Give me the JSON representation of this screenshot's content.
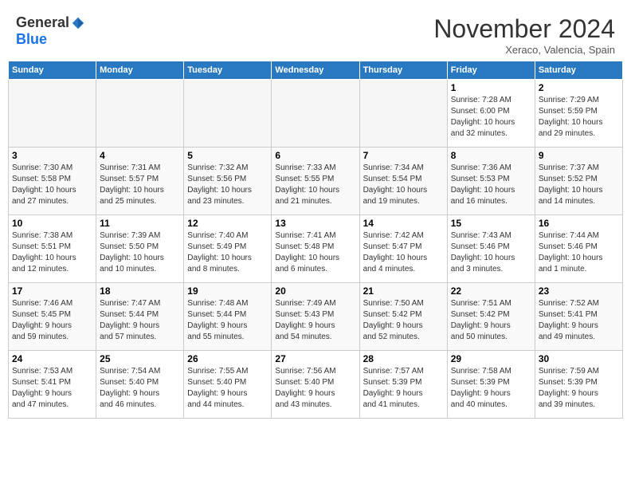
{
  "header": {
    "logo_general": "General",
    "logo_blue": "Blue",
    "month_title": "November 2024",
    "subtitle": "Xeraco, Valencia, Spain"
  },
  "days_of_week": [
    "Sunday",
    "Monday",
    "Tuesday",
    "Wednesday",
    "Thursday",
    "Friday",
    "Saturday"
  ],
  "weeks": [
    [
      {
        "day": "",
        "info": "",
        "empty": true
      },
      {
        "day": "",
        "info": "",
        "empty": true
      },
      {
        "day": "",
        "info": "",
        "empty": true
      },
      {
        "day": "",
        "info": "",
        "empty": true
      },
      {
        "day": "",
        "info": "",
        "empty": true
      },
      {
        "day": "1",
        "info": "Sunrise: 7:28 AM\nSunset: 6:00 PM\nDaylight: 10 hours\nand 32 minutes."
      },
      {
        "day": "2",
        "info": "Sunrise: 7:29 AM\nSunset: 5:59 PM\nDaylight: 10 hours\nand 29 minutes."
      }
    ],
    [
      {
        "day": "3",
        "info": "Sunrise: 7:30 AM\nSunset: 5:58 PM\nDaylight: 10 hours\nand 27 minutes."
      },
      {
        "day": "4",
        "info": "Sunrise: 7:31 AM\nSunset: 5:57 PM\nDaylight: 10 hours\nand 25 minutes."
      },
      {
        "day": "5",
        "info": "Sunrise: 7:32 AM\nSunset: 5:56 PM\nDaylight: 10 hours\nand 23 minutes."
      },
      {
        "day": "6",
        "info": "Sunrise: 7:33 AM\nSunset: 5:55 PM\nDaylight: 10 hours\nand 21 minutes."
      },
      {
        "day": "7",
        "info": "Sunrise: 7:34 AM\nSunset: 5:54 PM\nDaylight: 10 hours\nand 19 minutes."
      },
      {
        "day": "8",
        "info": "Sunrise: 7:36 AM\nSunset: 5:53 PM\nDaylight: 10 hours\nand 16 minutes."
      },
      {
        "day": "9",
        "info": "Sunrise: 7:37 AM\nSunset: 5:52 PM\nDaylight: 10 hours\nand 14 minutes."
      }
    ],
    [
      {
        "day": "10",
        "info": "Sunrise: 7:38 AM\nSunset: 5:51 PM\nDaylight: 10 hours\nand 12 minutes."
      },
      {
        "day": "11",
        "info": "Sunrise: 7:39 AM\nSunset: 5:50 PM\nDaylight: 10 hours\nand 10 minutes."
      },
      {
        "day": "12",
        "info": "Sunrise: 7:40 AM\nSunset: 5:49 PM\nDaylight: 10 hours\nand 8 minutes."
      },
      {
        "day": "13",
        "info": "Sunrise: 7:41 AM\nSunset: 5:48 PM\nDaylight: 10 hours\nand 6 minutes."
      },
      {
        "day": "14",
        "info": "Sunrise: 7:42 AM\nSunset: 5:47 PM\nDaylight: 10 hours\nand 4 minutes."
      },
      {
        "day": "15",
        "info": "Sunrise: 7:43 AM\nSunset: 5:46 PM\nDaylight: 10 hours\nand 3 minutes."
      },
      {
        "day": "16",
        "info": "Sunrise: 7:44 AM\nSunset: 5:46 PM\nDaylight: 10 hours\nand 1 minute."
      }
    ],
    [
      {
        "day": "17",
        "info": "Sunrise: 7:46 AM\nSunset: 5:45 PM\nDaylight: 9 hours\nand 59 minutes."
      },
      {
        "day": "18",
        "info": "Sunrise: 7:47 AM\nSunset: 5:44 PM\nDaylight: 9 hours\nand 57 minutes."
      },
      {
        "day": "19",
        "info": "Sunrise: 7:48 AM\nSunset: 5:44 PM\nDaylight: 9 hours\nand 55 minutes."
      },
      {
        "day": "20",
        "info": "Sunrise: 7:49 AM\nSunset: 5:43 PM\nDaylight: 9 hours\nand 54 minutes."
      },
      {
        "day": "21",
        "info": "Sunrise: 7:50 AM\nSunset: 5:42 PM\nDaylight: 9 hours\nand 52 minutes."
      },
      {
        "day": "22",
        "info": "Sunrise: 7:51 AM\nSunset: 5:42 PM\nDaylight: 9 hours\nand 50 minutes."
      },
      {
        "day": "23",
        "info": "Sunrise: 7:52 AM\nSunset: 5:41 PM\nDaylight: 9 hours\nand 49 minutes."
      }
    ],
    [
      {
        "day": "24",
        "info": "Sunrise: 7:53 AM\nSunset: 5:41 PM\nDaylight: 9 hours\nand 47 minutes."
      },
      {
        "day": "25",
        "info": "Sunrise: 7:54 AM\nSunset: 5:40 PM\nDaylight: 9 hours\nand 46 minutes."
      },
      {
        "day": "26",
        "info": "Sunrise: 7:55 AM\nSunset: 5:40 PM\nDaylight: 9 hours\nand 44 minutes."
      },
      {
        "day": "27",
        "info": "Sunrise: 7:56 AM\nSunset: 5:40 PM\nDaylight: 9 hours\nand 43 minutes."
      },
      {
        "day": "28",
        "info": "Sunrise: 7:57 AM\nSunset: 5:39 PM\nDaylight: 9 hours\nand 41 minutes."
      },
      {
        "day": "29",
        "info": "Sunrise: 7:58 AM\nSunset: 5:39 PM\nDaylight: 9 hours\nand 40 minutes."
      },
      {
        "day": "30",
        "info": "Sunrise: 7:59 AM\nSunset: 5:39 PM\nDaylight: 9 hours\nand 39 minutes."
      }
    ]
  ]
}
